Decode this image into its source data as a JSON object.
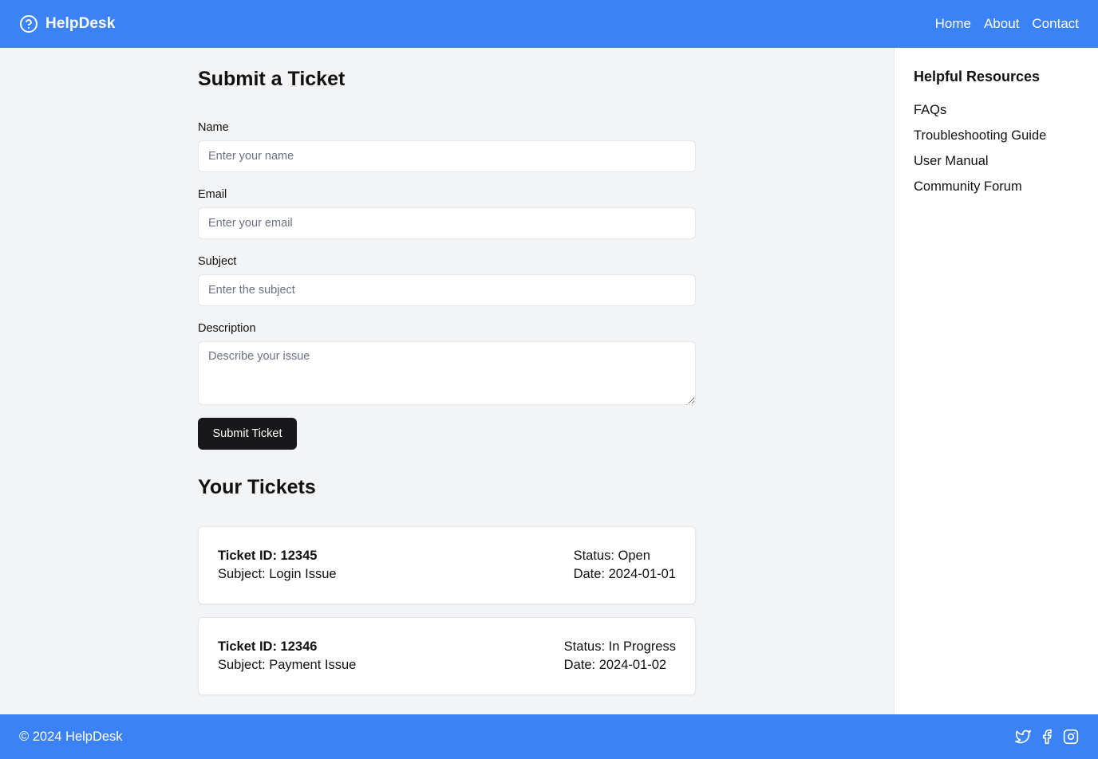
{
  "header": {
    "brand": "HelpDesk",
    "brand_icon": "help-circle-icon",
    "nav": [
      "Home",
      "About",
      "Contact"
    ]
  },
  "form": {
    "title": "Submit a Ticket",
    "name": {
      "label": "Name",
      "placeholder": "Enter your name",
      "value": ""
    },
    "email": {
      "label": "Email",
      "placeholder": "Enter your email",
      "value": ""
    },
    "subject": {
      "label": "Subject",
      "placeholder": "Enter the subject",
      "value": ""
    },
    "description": {
      "label": "Description",
      "placeholder": "Describe your issue",
      "value": ""
    },
    "submit_label": "Submit Ticket"
  },
  "tickets": {
    "title": "Your Tickets",
    "items": [
      {
        "id": "Ticket ID: 12345",
        "subject": "Subject: Login Issue",
        "status": "Status: Open",
        "date": "Date: 2024-01-01"
      },
      {
        "id": "Ticket ID: 12346",
        "subject": "Subject: Payment Issue",
        "status": "Status: In Progress",
        "date": "Date: 2024-01-02"
      }
    ]
  },
  "sidebar": {
    "title": "Helpful Resources",
    "links": [
      "FAQs",
      "Troubleshooting Guide",
      "User Manual",
      "Community Forum"
    ]
  },
  "footer": {
    "copyright": "© 2024 HelpDesk",
    "socials": [
      "twitter-icon",
      "facebook-icon",
      "instagram-icon"
    ]
  },
  "colors": {
    "brand": "#3b82f6",
    "button": "#18181b",
    "background": "#f3f4f6"
  }
}
